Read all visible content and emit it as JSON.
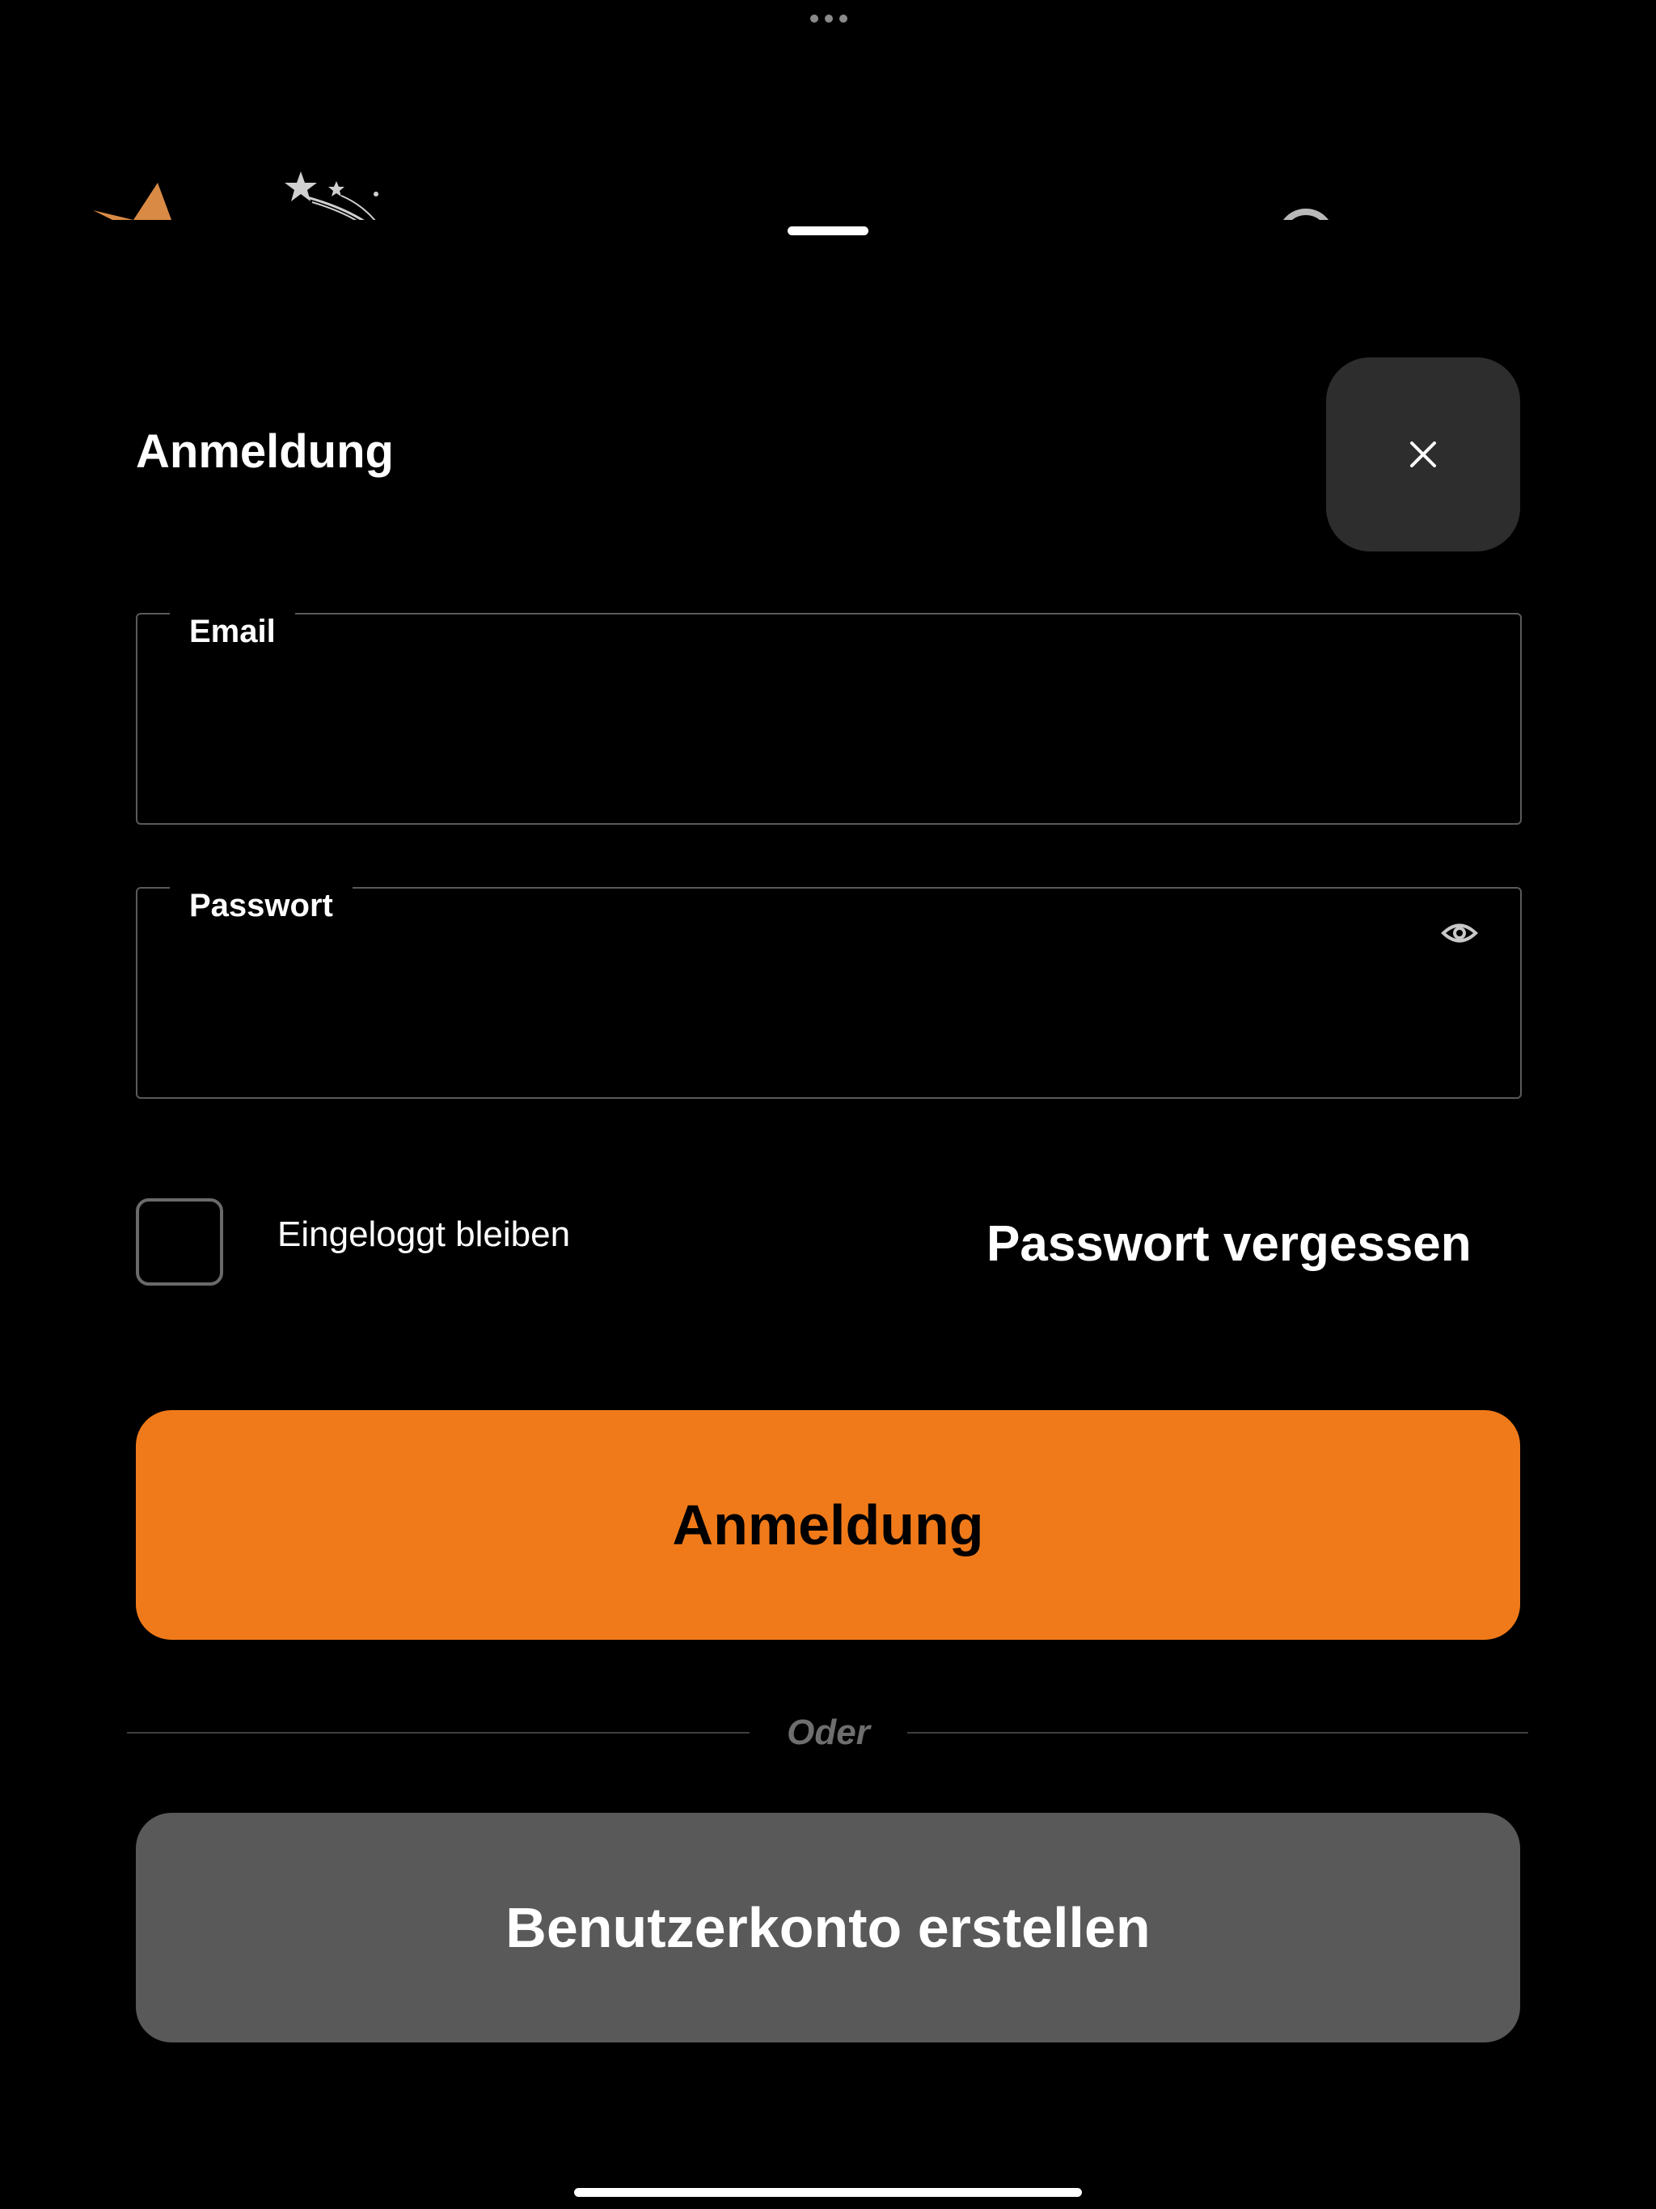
{
  "sheet": {
    "title": "Anmeldung",
    "close_icon": "close-icon"
  },
  "form": {
    "email": {
      "label": "Email",
      "value": "",
      "placeholder": ""
    },
    "password": {
      "label": "Passwort",
      "value": "",
      "placeholder": "",
      "toggle_icon": "eye-icon"
    },
    "remember": {
      "label": "Eingeloggt bleiben",
      "checked": false
    },
    "forgot_label": "Passwort vergessen",
    "login_label": "Anmeldung",
    "divider_label": "Oder",
    "register_label": "Benutzerkonto erstellen"
  },
  "colors": {
    "background": "#000000",
    "accent": "#f07a1a",
    "secondary_button": "#595959",
    "close_button": "#2d2d2d",
    "logo_accent": "#d98a45"
  }
}
